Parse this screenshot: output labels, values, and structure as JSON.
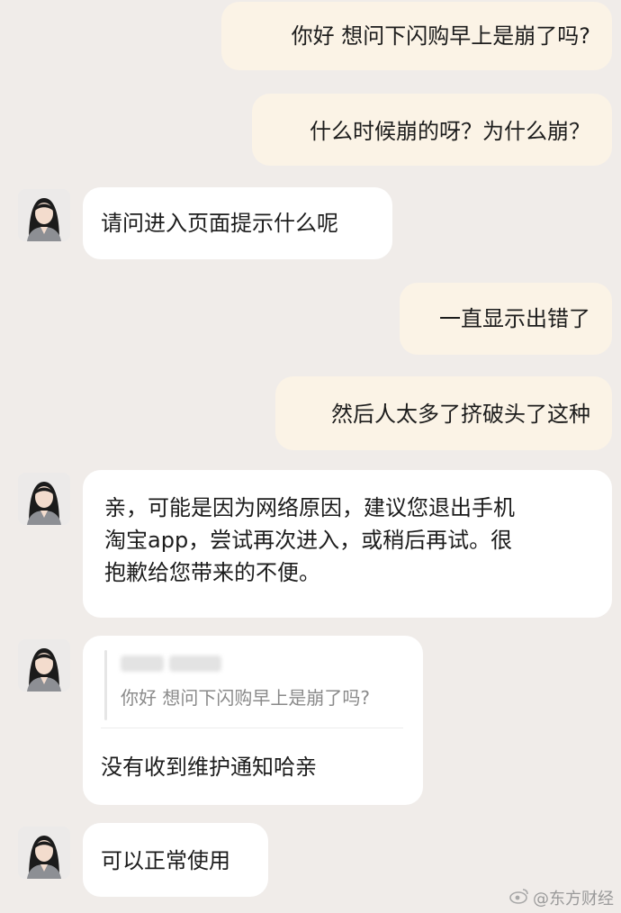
{
  "messages": [
    {
      "side": "out",
      "text": "你好 想问下闪购早上是崩了吗?"
    },
    {
      "side": "out",
      "text": "什么时候崩的呀？为什么崩？"
    },
    {
      "side": "in",
      "text": "请问进入页面提示什么呢"
    },
    {
      "side": "out",
      "text": "一直显示出错了"
    },
    {
      "side": "out",
      "text": "然后人太多了挤破头了这种"
    },
    {
      "side": "in",
      "lines": [
        "亲，可能是因为网络原因，建议您退出手机",
        "淘宝app，尝试再次进入，或稍后再试。很",
        "抱歉给您带来的不便。"
      ]
    },
    {
      "side": "in",
      "quote": {
        "text": "你好 想问下闪购早上是崩了吗?"
      },
      "text": "没有收到维护通知哈亲"
    },
    {
      "side": "in",
      "text": "可以正常使用"
    }
  ],
  "watermark": {
    "text": "@东方财经",
    "icon": "weibo-icon"
  },
  "colors": {
    "background": "#f0ece9",
    "outgoing_bubble": "#fbf3e6",
    "incoming_bubble": "#ffffff"
  }
}
